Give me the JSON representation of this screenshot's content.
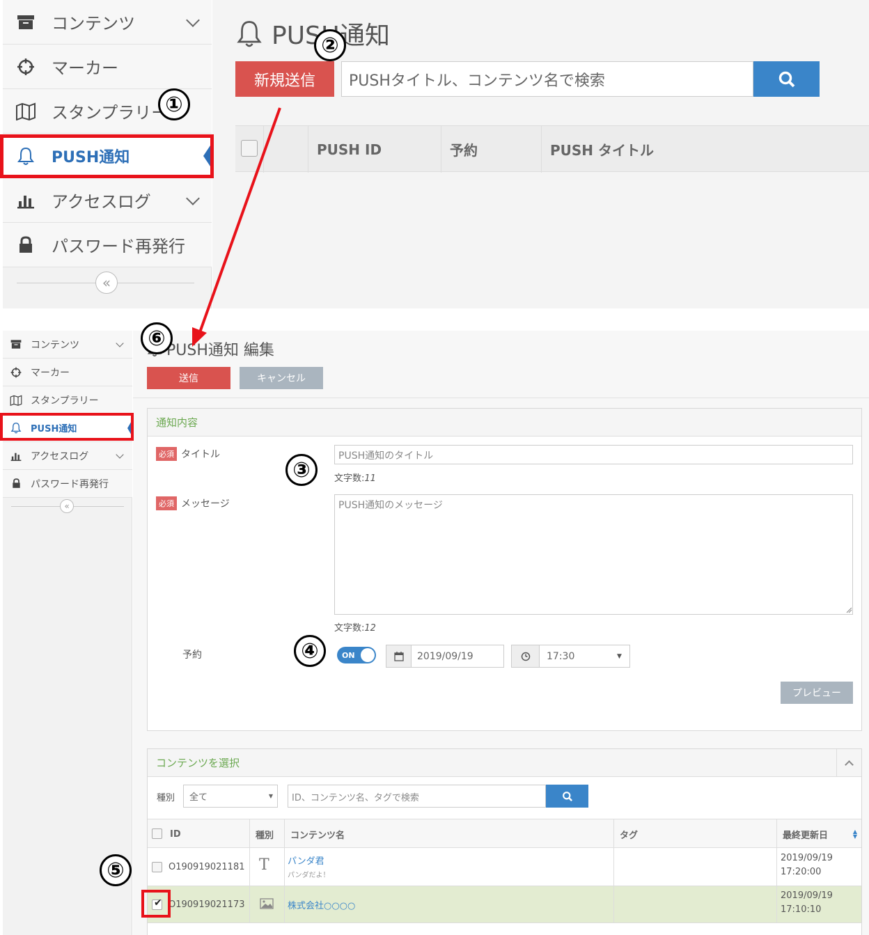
{
  "top": {
    "sidebar": [
      {
        "label": "コンテンツ",
        "icon": "archive-icon",
        "chevron": true
      },
      {
        "label": "マーカー",
        "icon": "crosshair-icon"
      },
      {
        "label": "スタンプラリー",
        "icon": "map-icon"
      },
      {
        "label": "PUSH通知",
        "icon": "bell-icon",
        "active": true
      },
      {
        "label": "アクセスログ",
        "icon": "bar-chart-icon",
        "chevron": true
      },
      {
        "label": "パスワード再発行",
        "icon": "lock-icon"
      }
    ],
    "collapse_symbol": "«",
    "title": "PUSH通知",
    "new_button": "新規送信",
    "search_placeholder": "PUSHタイトル、コンテンツ名で検索",
    "columns": [
      "PUSH ID",
      "予約",
      "PUSH タイトル"
    ]
  },
  "bottom": {
    "sidebar": [
      {
        "label": "コンテンツ",
        "icon": "archive-icon",
        "chevron": true
      },
      {
        "label": "マーカー",
        "icon": "crosshair-icon"
      },
      {
        "label": "スタンプラリー",
        "icon": "map-icon"
      },
      {
        "label": "PUSH通知",
        "icon": "bell-icon",
        "active": true
      },
      {
        "label": "アクセスログ",
        "icon": "bar-chart-icon",
        "chevron": true
      },
      {
        "label": "パスワード再発行",
        "icon": "lock-icon"
      }
    ],
    "collapse_symbol": "«",
    "title": "PUSH通知 編集",
    "send_button": "送信",
    "cancel_button": "キャンセル",
    "notification_panel": {
      "heading": "通知内容",
      "required_badge": "必須",
      "title_label": "タイトル",
      "title_value": "PUSH通知のタイトル",
      "title_count_label": "文字数:",
      "title_count": "11",
      "message_label": "メッセージ",
      "message_value": "PUSH通知のメッセージ",
      "message_count_label": "文字数:",
      "message_count": "12",
      "schedule_label": "予約",
      "toggle_text": "ON",
      "date": "2019/09/19",
      "time": "17:30",
      "preview_button": "プレビュー"
    },
    "content_panel": {
      "heading": "コンテンツを選択",
      "type_label": "種別",
      "type_value": "全て",
      "search_placeholder": "ID、コンテンツ名、タグで検索",
      "columns": {
        "id": "ID",
        "type": "種別",
        "name": "コンテンツ名",
        "tag": "タグ",
        "updated": "最終更新日"
      },
      "rows": [
        {
          "id": "O190919021181",
          "type_icon": "text-icon",
          "type_glyph": "T",
          "name": "パンダ君",
          "sub": "パンダだよ！",
          "tag": "",
          "date": "2019/09/19",
          "time": "17:20:00",
          "checked": false
        },
        {
          "id": "O190919021173",
          "type_icon": "image-icon",
          "name": "株式会社○○○○",
          "sub": "",
          "tag": "",
          "date": "2019/09/19",
          "time": "17:10:10",
          "checked": true
        }
      ]
    }
  },
  "markers": [
    "①",
    "②",
    "③",
    "④",
    "⑤",
    "⑥"
  ],
  "colors": {
    "accent_blue": "#3a85c9",
    "send_red": "#d9534f",
    "annotation_red": "#e8121a",
    "section_green": "#6aa84f",
    "selected_row": "#e3ecd1"
  }
}
